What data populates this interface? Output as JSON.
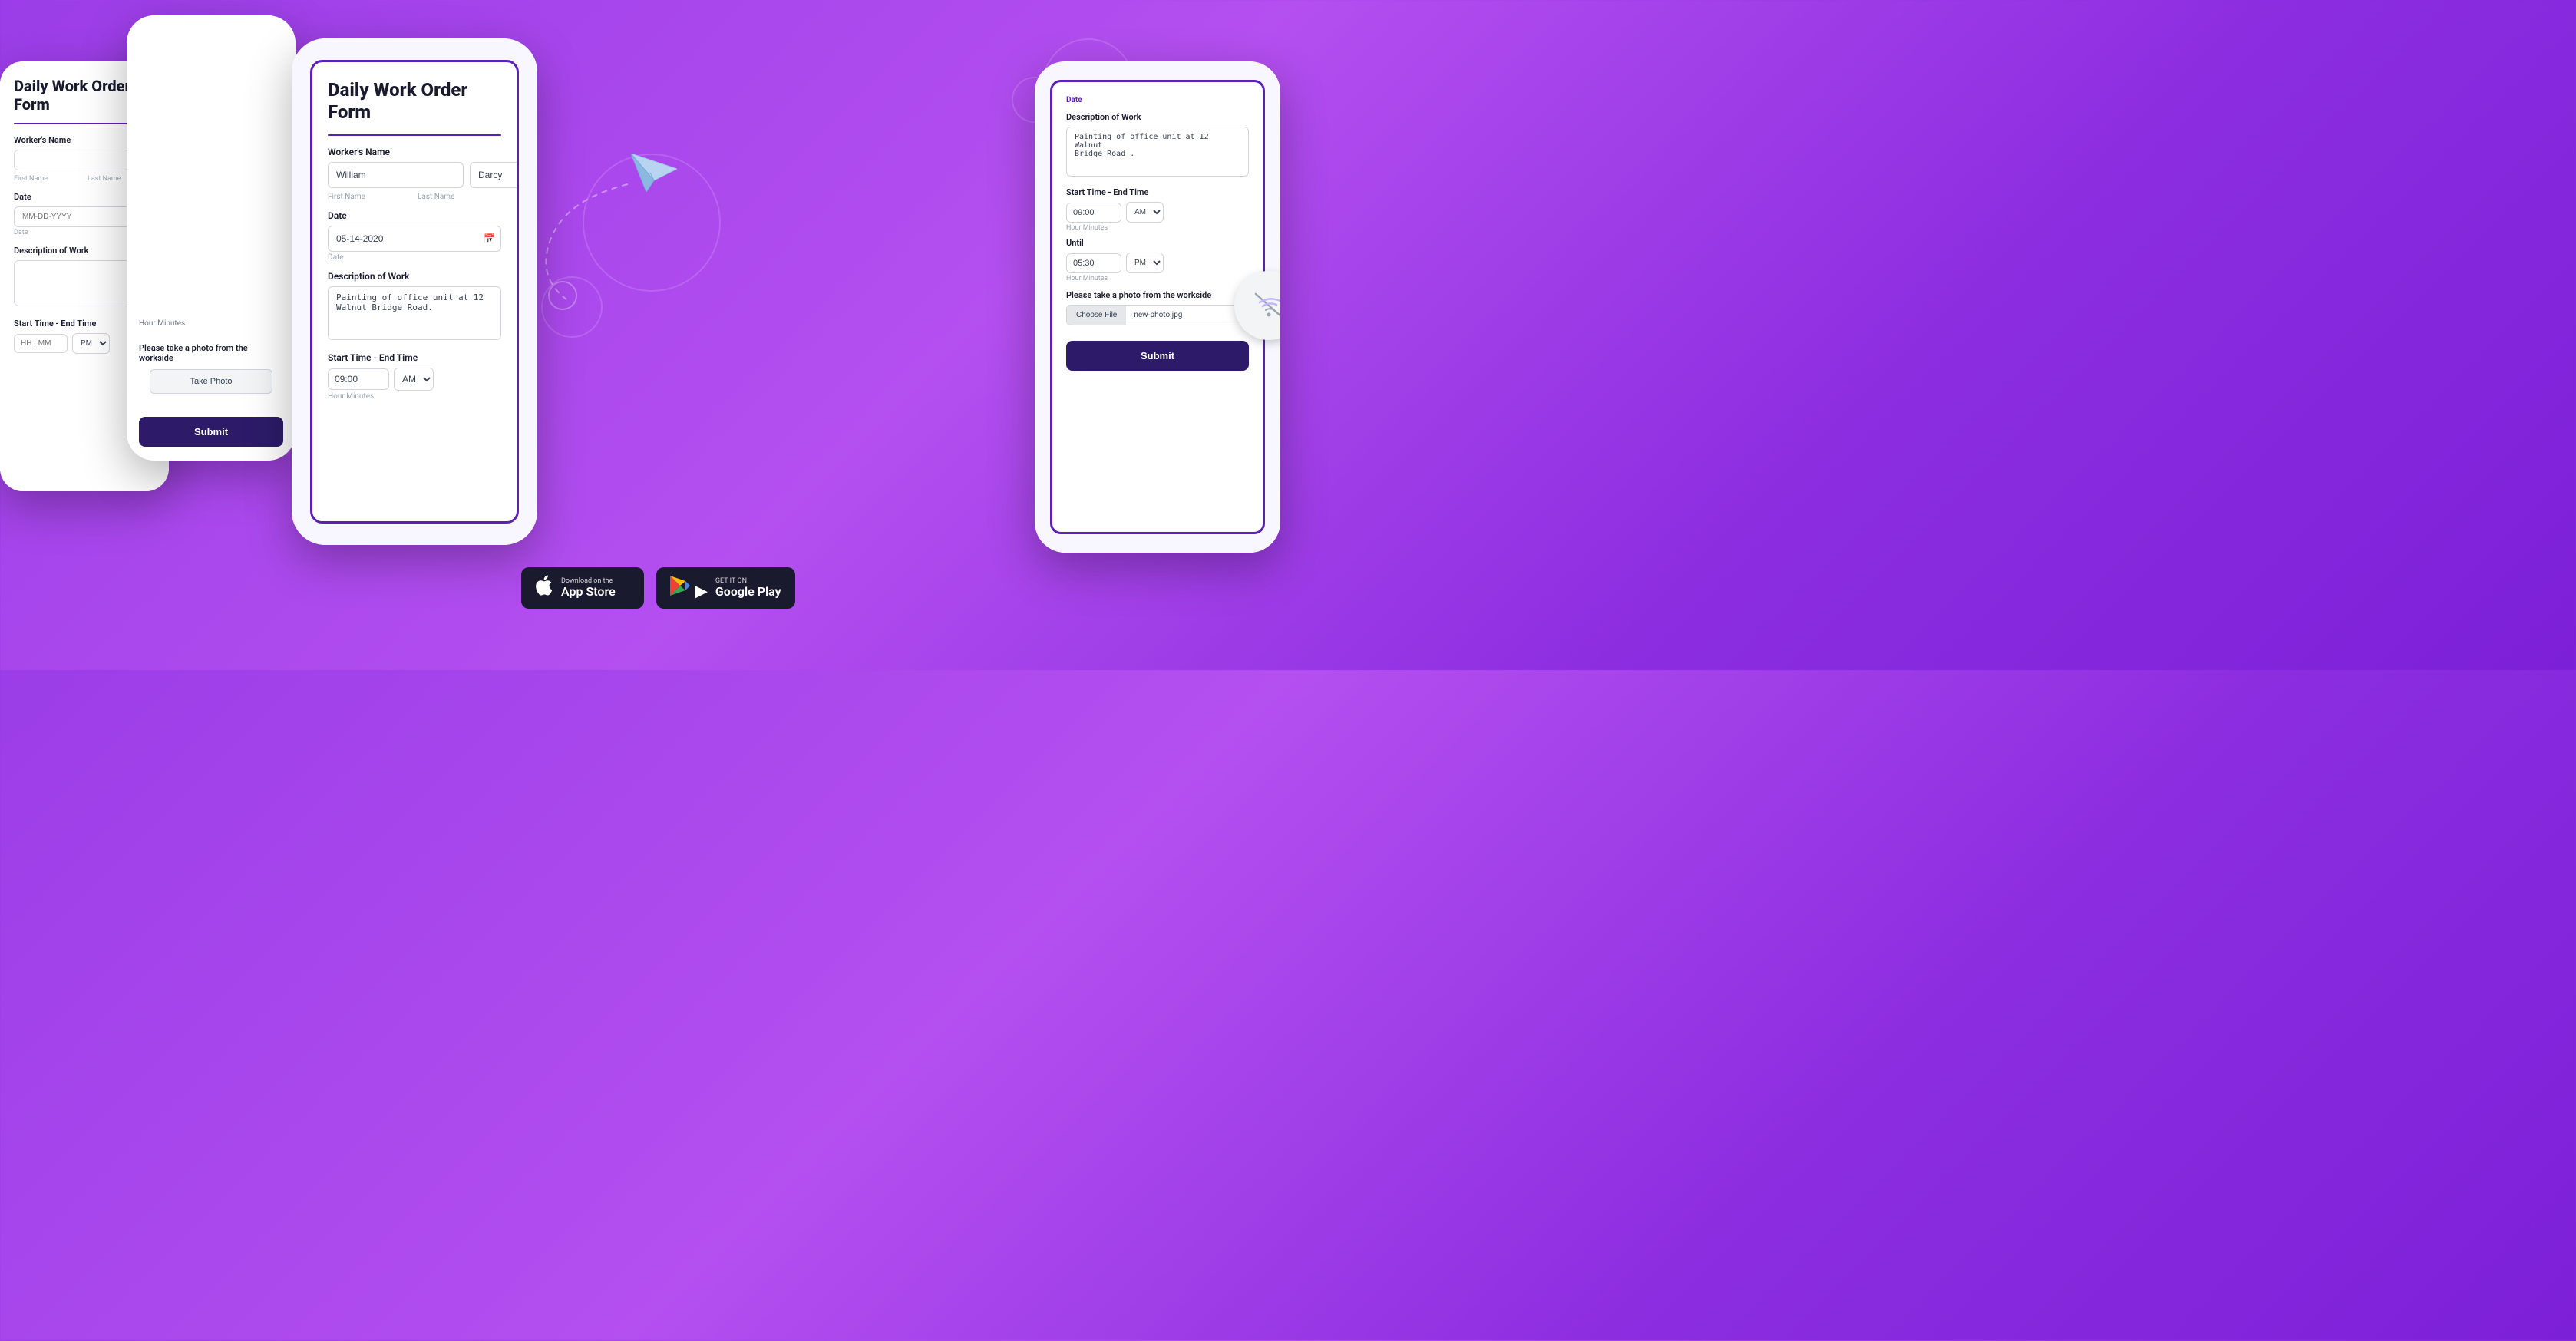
{
  "background": {
    "color": "#9b3de8"
  },
  "phone1": {
    "title": "Daily Work Order Form",
    "workers_name_label": "Worker's Name",
    "first_name_label": "First Name",
    "last_name_label": "Last Name",
    "date_label": "Date",
    "date_placeholder": "MM-DD-YYYY",
    "date_sublabel": "Date",
    "description_label": "Description of Work",
    "start_time_label": "Start Time - End Time",
    "time_placeholder": "HH : MM",
    "am_pm_options": [
      "AM",
      "PM"
    ],
    "am_pm_default": "PM"
  },
  "phone2": {
    "photo_section_label": "Please take a photo from the workside",
    "take_photo_btn": "Take Photo",
    "submit_btn": "Submit"
  },
  "phone3": {
    "title": "Daily Work Order Form",
    "workers_name_label": "Worker's Name",
    "first_name_value": "William",
    "last_name_value": "Darcy",
    "first_name_label": "First Name",
    "last_name_label": "Last Name",
    "date_label": "Date",
    "date_value": "05-14-2020",
    "date_sublabel": "Date",
    "description_label": "Description of Work",
    "description_value": "Painting of office unit at 12 Walnut\nBridge Road.",
    "start_time_label": "Start Time - End Time",
    "start_time_value": "09:00",
    "am_pm_value": "AM",
    "hour_minutes_label": "Hour Minutes"
  },
  "phone4": {
    "date_label": "Date",
    "description_label": "Description of Work",
    "description_value": "Painting of office unit at 12 Walnut\nBridge Road .",
    "start_time_label": "Start Time - End Time",
    "start_time_value": "09:00",
    "start_am_pm": "AM",
    "hour_minutes_label": "Hour Minutes",
    "until_label": "Until",
    "end_time_value": "05:30",
    "end_am_pm": "PM",
    "end_hour_minutes_label": "Hour Minutes",
    "photo_label": "Please take a photo from the workside",
    "choose_file_btn": "Choose File",
    "file_name": "new-photo.jpg",
    "submit_btn": "Submit"
  },
  "app_store": {
    "apple_top": "Download on the",
    "apple_main": "App Store",
    "google_top": "GET IT ON",
    "google_main": "Google Play"
  }
}
